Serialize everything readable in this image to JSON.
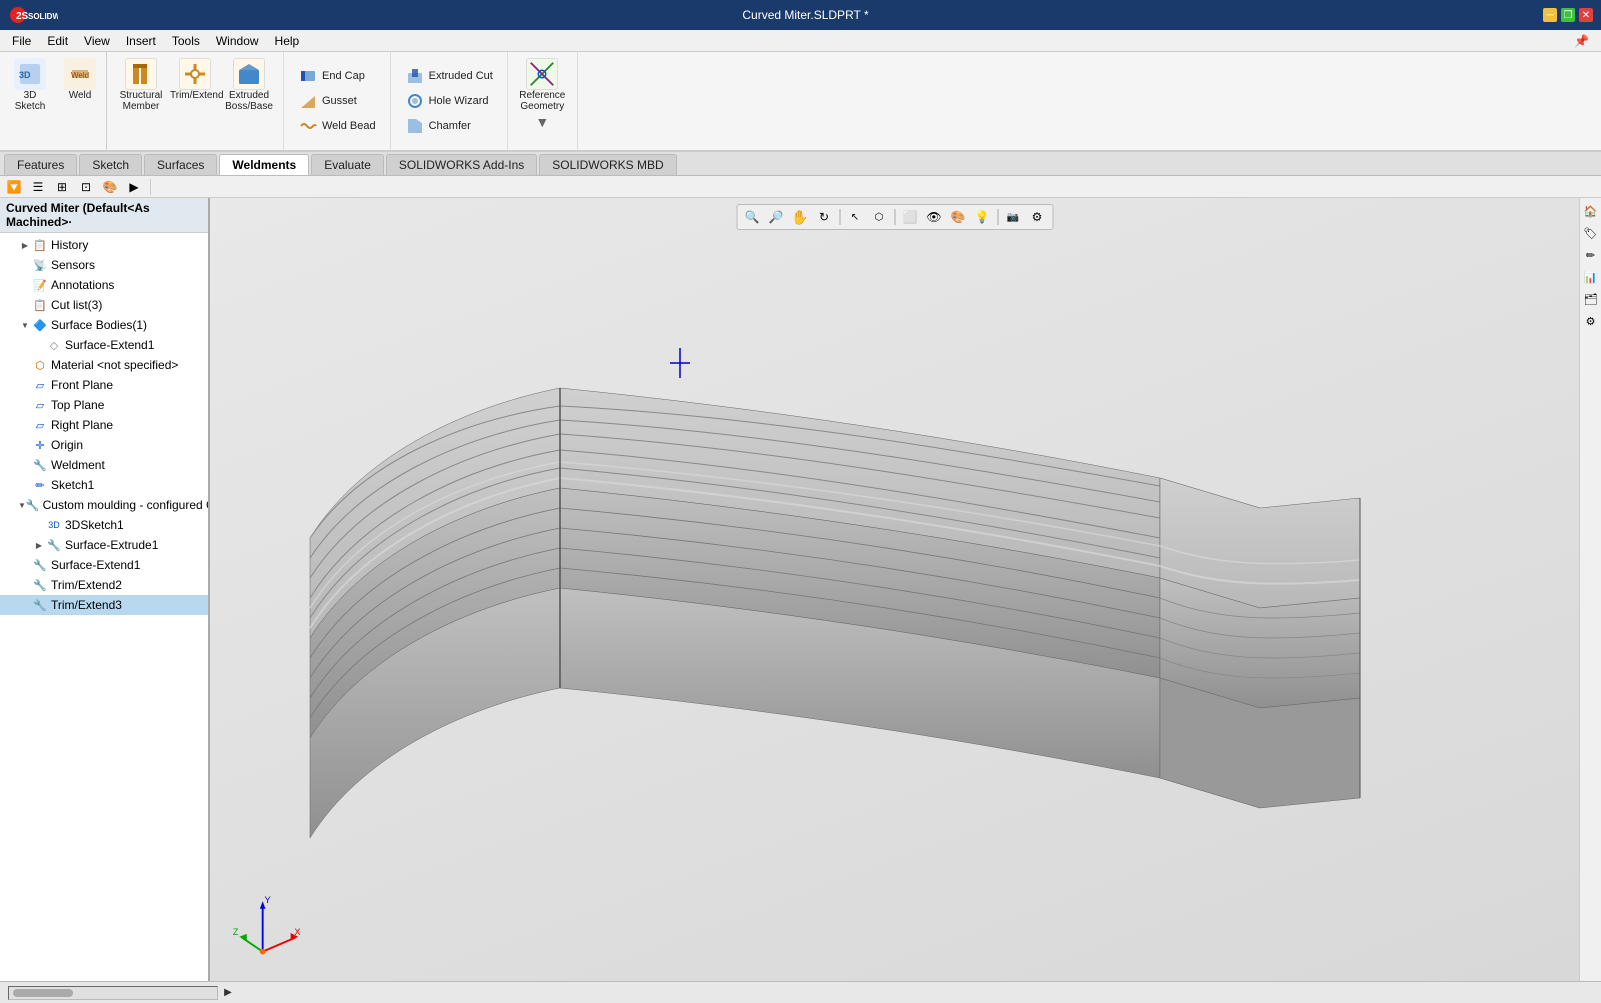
{
  "titlebar": {
    "title": "Curved Miter.SLDPRT *",
    "minimize": "─",
    "restore": "❐",
    "close": "✕"
  },
  "menubar": {
    "items": [
      "File",
      "Edit",
      "View",
      "Insert",
      "Tools",
      "Window",
      "Help"
    ]
  },
  "ribbon": {
    "tabs": [
      "Features",
      "Sketch",
      "Surfaces",
      "Weldments",
      "Evaluate",
      "SOLIDWORKS Add-Ins",
      "SOLIDWORKS MBD"
    ],
    "active_tab": "Weldments",
    "sections": {
      "sketch_tools": {
        "btn1": "3D Sketch",
        "btn2": "Weld"
      },
      "weldment_tools": [
        {
          "label": "Structural Member",
          "icon": "🔩"
        },
        {
          "label": "Trim/Extend",
          "icon": "✂"
        },
        {
          "label": "Extruded Boss/Base",
          "icon": "⬛"
        }
      ],
      "small_tools": [
        {
          "label": "End Cap",
          "icon": "⬜"
        },
        {
          "label": "Gusset",
          "icon": "△"
        },
        {
          "label": "Weld Bead",
          "icon": "〰"
        }
      ],
      "right_tools": [
        {
          "label": "Extruded Cut",
          "icon": "⬛"
        },
        {
          "label": "Hole Wizard",
          "icon": "⭕"
        },
        {
          "label": "Chamfer",
          "icon": "◿"
        }
      ],
      "ref_geometry": {
        "label": "Reference Geometry",
        "icon": "📐"
      }
    }
  },
  "sidebar": {
    "title": "Curved Miter  (Default<As Machined>·",
    "toolbar_icons": [
      "filter",
      "list",
      "group",
      "move",
      "color",
      "arrow"
    ],
    "tree": [
      {
        "id": "history",
        "label": "History",
        "icon": "📋",
        "indent": 1,
        "expand": true,
        "color": "orange"
      },
      {
        "id": "sensors",
        "label": "Sensors",
        "icon": "📡",
        "indent": 1,
        "expand": false,
        "color": "orange"
      },
      {
        "id": "annotations",
        "label": "Annotations",
        "icon": "📝",
        "indent": 1,
        "expand": false,
        "color": "orange"
      },
      {
        "id": "cutlist",
        "label": "Cut list(3)",
        "icon": "📋",
        "indent": 1,
        "expand": false,
        "color": "orange"
      },
      {
        "id": "solidbodies",
        "label": "Surface Bodies(1)",
        "icon": "🔷",
        "indent": 1,
        "expand": true,
        "color": "blue"
      },
      {
        "id": "surfaceextend1",
        "label": "Surface-Extend1",
        "icon": "◇",
        "indent": 2,
        "expand": false,
        "color": "gray"
      },
      {
        "id": "material",
        "label": "Material <not specified>",
        "icon": "⬡",
        "indent": 1,
        "expand": false,
        "color": "orange"
      },
      {
        "id": "frontplane",
        "label": "Front Plane",
        "icon": "▱",
        "indent": 1,
        "expand": false,
        "color": "blue"
      },
      {
        "id": "topplane",
        "label": "Top Plane",
        "icon": "▱",
        "indent": 1,
        "expand": false,
        "color": "blue"
      },
      {
        "id": "rightplane",
        "label": "Right Plane",
        "icon": "▱",
        "indent": 1,
        "expand": false,
        "color": "blue"
      },
      {
        "id": "origin",
        "label": "Origin",
        "icon": "✛",
        "indent": 1,
        "expand": false,
        "color": "blue"
      },
      {
        "id": "weldment",
        "label": "Weldment",
        "icon": "🔧",
        "indent": 1,
        "expand": false,
        "color": "orange"
      },
      {
        "id": "sketch1",
        "label": "Sketch1",
        "icon": "✏",
        "indent": 1,
        "expand": false,
        "color": "blue"
      },
      {
        "id": "custommoulding",
        "label": "Custom moulding - configured CL...",
        "icon": "🔧",
        "indent": 1,
        "expand": true,
        "color": "orange"
      },
      {
        "id": "3dsketch1",
        "label": "3DSketch1",
        "icon": "✏",
        "indent": 2,
        "expand": false,
        "color": "blue"
      },
      {
        "id": "surfaceextrude1",
        "label": "Surface-Extrude1",
        "icon": "🔧",
        "indent": 2,
        "expand": false,
        "color": "orange"
      },
      {
        "id": "surfaceextend1b",
        "label": "Surface-Extend1",
        "icon": "🔧",
        "indent": 1,
        "expand": false,
        "color": "orange"
      },
      {
        "id": "trimextend2",
        "label": "Trim/Extend2",
        "icon": "🔧",
        "indent": 1,
        "expand": false,
        "color": "orange"
      },
      {
        "id": "trimextend3",
        "label": "Trim/Extend3",
        "icon": "🔧",
        "indent": 1,
        "expand": false,
        "color": "orange",
        "selected": true
      }
    ]
  },
  "viewport": {
    "toolbar": [
      "🔍",
      "🔎",
      "🔬",
      "⬚",
      "✋",
      "↩",
      "↪",
      "🎯",
      "⬜",
      "◻",
      "⬡",
      "◎",
      "🔆",
      "📷",
      "⚙"
    ]
  },
  "statusbar": {
    "text": ""
  },
  "right_panel": {
    "icons": [
      "📂",
      "🏷",
      "🖊",
      "📊",
      "🗂",
      "⚙"
    ]
  }
}
